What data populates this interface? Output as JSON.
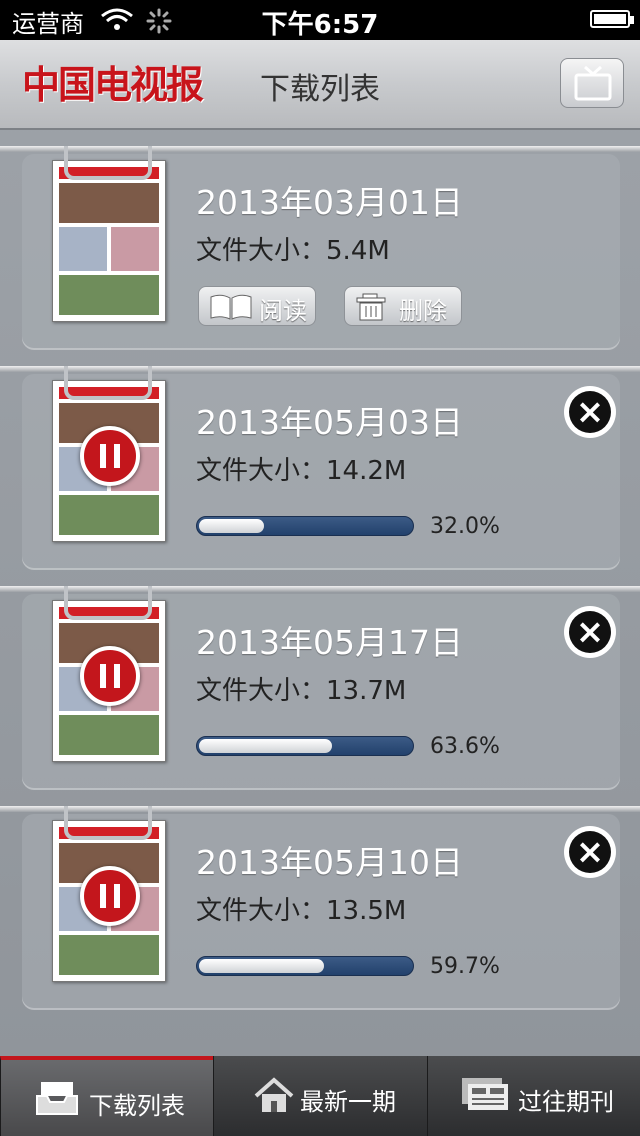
{
  "status": {
    "carrier": "运营商",
    "time": "下午6:57"
  },
  "header": {
    "logo": "中国电视报",
    "title": "下载列表"
  },
  "size_label": "文件大小：",
  "items": [
    {
      "date": "2013年03月01日",
      "size": "5.4M",
      "state": "downloaded",
      "read_label": "阅读",
      "delete_label": "删除"
    },
    {
      "date": "2013年05月03日",
      "size": "14.2M",
      "state": "paused",
      "progress_text": "32.0%",
      "progress": 0.32
    },
    {
      "date": "2013年05月17日",
      "size": "13.7M",
      "state": "paused",
      "progress_text": "63.6%",
      "progress": 0.636
    },
    {
      "date": "2013年05月10日",
      "size": "13.5M",
      "state": "paused",
      "progress_text": "59.7%",
      "progress": 0.597
    }
  ],
  "tabs": [
    {
      "label": "下载列表",
      "icon": "inbox-tray-icon",
      "active": true
    },
    {
      "label": "最新一期",
      "icon": "home-icon",
      "active": false
    },
    {
      "label": "过往期刊",
      "icon": "newspaper-stack-icon",
      "active": false
    }
  ],
  "colors": {
    "brand_red": "#c3161c",
    "progress_blue": "#22416c"
  }
}
